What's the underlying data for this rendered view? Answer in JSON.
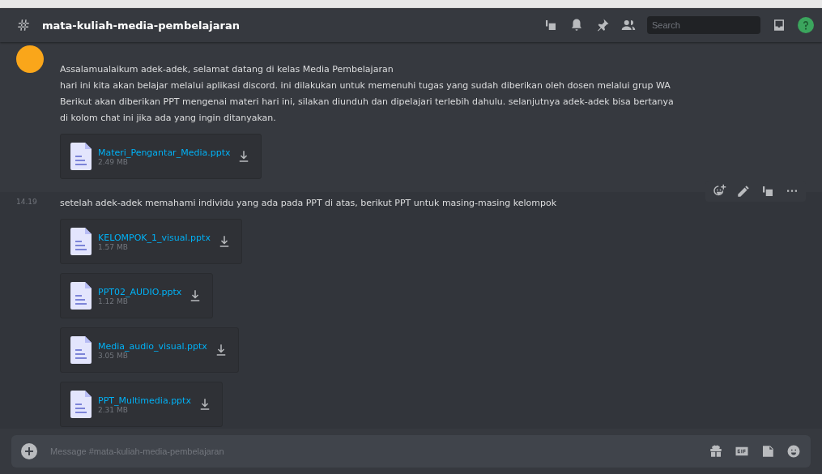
{
  "header": {
    "channel": "mata-kuliah-media-pembelajaran",
    "search": {
      "placeholder": "Search"
    }
  },
  "messages": [
    {
      "kind": "first",
      "lines": [
        "Assalamualaikum adek-adek, selamat datang di kelas Media Pembelajaran",
        "hari ini kita akan belajar melalui aplikasi discord. ini dilakukan untuk memenuhi tugas yang sudah diberikan oleh dosen melalui grup WA",
        "Berikut akan diberikan PPT mengenai materi hari ini, silakan diunduh dan dipelajari terlebih dahulu. selanjutnya adek-adek bisa bertanya",
        "di kolom chat ini jika ada yang ingin ditanyakan."
      ],
      "files": [
        {
          "name": "Materi_Pengantar_Media.pptx",
          "size": "2.49 MB"
        }
      ]
    },
    {
      "kind": "followup",
      "time": "14.19",
      "lines": [
        "setelah adek-adek memahami individu yang ada pada PPT di atas, berikut PPT untuk masing-masing kelompok"
      ],
      "files": [
        {
          "name": "KELOMPOK_1_visual.pptx",
          "size": "1.57 MB"
        },
        {
          "name": "PPT02_AUDIO.pptx",
          "size": "1.12 MB"
        },
        {
          "name": "Media_audio_visual.pptx",
          "size": "3.05 MB"
        },
        {
          "name": "PPT_Multimedia.pptx",
          "size": "2.31 MB"
        }
      ]
    }
  ],
  "composer": {
    "placeholder": "Message #mata-kuliah-media-pembelajaran"
  }
}
